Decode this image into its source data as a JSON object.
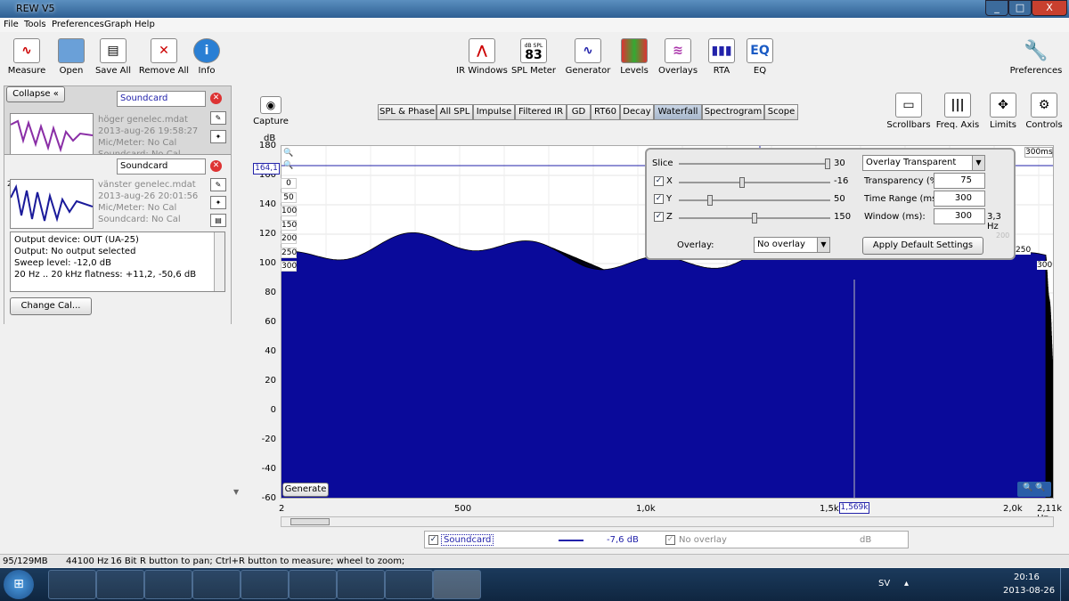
{
  "window": {
    "title": "REW V5",
    "minimize": "_",
    "maximize": "□",
    "close": "X"
  },
  "menu": [
    "File",
    "Tools",
    "Preferences",
    "Graph",
    "Help"
  ],
  "toolbar_left": [
    "Measure",
    "Open",
    "Save All",
    "Remove All",
    "Info"
  ],
  "toolbar_center": [
    "IR Windows",
    "SPL Meter",
    "Generator",
    "Levels",
    "Overlays",
    "RTA",
    "EQ"
  ],
  "spl_meter_icon": {
    "top": "dB SPL",
    "value": "83"
  },
  "eq_icon": "EQ",
  "preferences": "Preferences",
  "right_buttons": [
    "Scrollbars",
    "Freq. Axis",
    "Limits",
    "Controls"
  ],
  "capture": "Capture",
  "tabs": [
    "SPL & Phase",
    "All SPL",
    "Impulse",
    "Filtered IR",
    "GD",
    "RT60",
    "Decay",
    "Waterfall",
    "Spectrogram",
    "Scope"
  ],
  "selected_tab": "Waterfall",
  "left": {
    "collapse": "Collapse",
    "m1": {
      "device": "Soundcard",
      "name": "höger genelec.mdat",
      "date": "2013-aug-26 19:58:27",
      "cal": "Mic/Meter: No Cal",
      "sound": "Soundcard: No Cal"
    },
    "m2": {
      "device": "Soundcard",
      "name": "vänster genelec.mdat",
      "date": "2013-aug-26 20:01:56",
      "cal": "Mic/Meter: No Cal",
      "sound": "Soundcard: No Cal"
    },
    "info": [
      "Output device: OUT (UA-25)",
      "Output: No output selected",
      "Sweep level: -12,0 dB",
      "20 Hz .. 20 kHz flatness: +11,2, -50,6 dB"
    ],
    "change_cal": "Change Cal..."
  },
  "graph": {
    "y_unit": "dB",
    "y_ticks": [
      "180",
      "160",
      "140",
      "120",
      "100",
      "80",
      "60",
      "40",
      "20",
      "0",
      "-20",
      "-40",
      "-60"
    ],
    "x_ticks": [
      "2",
      "500",
      "1,0k",
      "1,5k",
      "2,0k",
      "2,11k Hz"
    ],
    "cursor_y": "164,1",
    "cursor_x": "1,569k",
    "time_ticks": [
      "0",
      "50",
      "100",
      "150",
      "200",
      "250",
      "300"
    ],
    "right_time": [
      "300ms",
      "250",
      "300"
    ],
    "generate": "Generate",
    "fill_color": "#0a0a9a"
  },
  "controls": {
    "slice": {
      "label": "Slice",
      "value": "30"
    },
    "x": {
      "label": "X",
      "value": "-16"
    },
    "y": {
      "label": "Y",
      "value": "50"
    },
    "z": {
      "label": "Z",
      "value": "150"
    },
    "mode": "Overlay Transparent",
    "transparency": {
      "label": "Transparency (%)",
      "value": "75"
    },
    "time_range": {
      "label": "Time Range (ms):",
      "value": "300"
    },
    "window": {
      "label": "Window (ms):",
      "value": "300",
      "extra": "3,3 Hz"
    },
    "overlay_label": "Overlay:",
    "overlay_value": "No overlay",
    "apply": "Apply Default Settings",
    "faint": "200"
  },
  "legend": {
    "name": "Soundcard",
    "value": "-7,6 dB",
    "overlay": "No overlay",
    "unit": "dB"
  },
  "status": [
    "95/129MB",
    "44100 Hz",
    "16 Bit",
    "R button to pan; Ctrl+R button to measure; wheel to zoom;"
  ],
  "tray": {
    "lang": "SV",
    "time": "20:16",
    "date": "2013-08-26"
  }
}
